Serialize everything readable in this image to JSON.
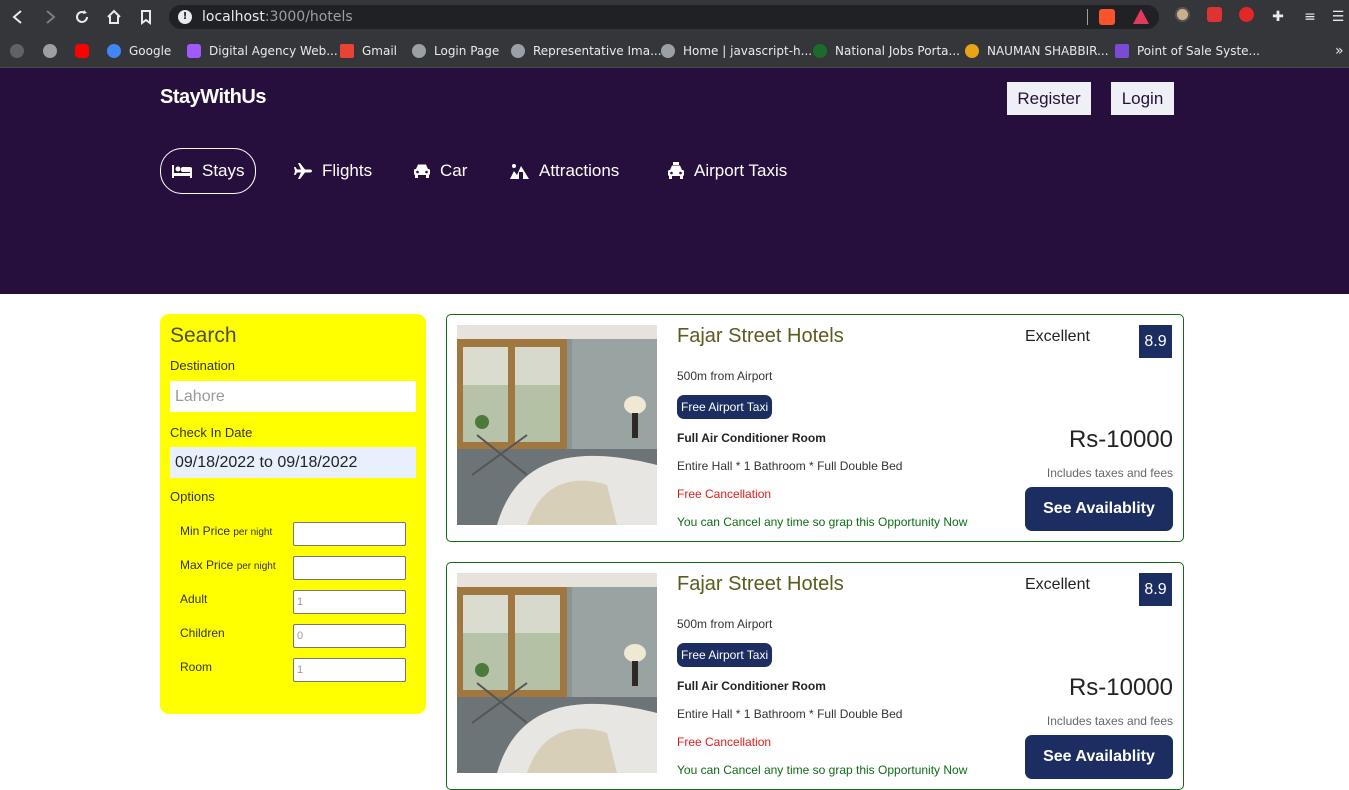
{
  "browser": {
    "url_host": "localhost",
    "url_path": ":3000/hotels",
    "bookmarks": [
      {
        "label": "",
        "color": "#9aa0a6"
      },
      {
        "label": "",
        "color": "#ff0000"
      },
      {
        "label": "Google",
        "color": "#4285f4"
      },
      {
        "label": "Digital Agency Web...",
        "color": "#a259ff"
      },
      {
        "label": "Gmail",
        "color": "#ea4335"
      },
      {
        "label": "Login Page",
        "color": "#9aa0a6"
      },
      {
        "label": "Representative Ima...",
        "color": "#9aa0a6"
      },
      {
        "label": "Home | javascript-h...",
        "color": "#9aa0a6"
      },
      {
        "label": "National Jobs Porta...",
        "color": "#1b6b2a"
      },
      {
        "label": "NAUMAN SHABBIR...",
        "color": "#e8a317"
      },
      {
        "label": "Point of Sale Syste...",
        "color": "#7b4bd6"
      }
    ],
    "more": "»"
  },
  "header": {
    "logo": "StayWithUs",
    "register": "Register",
    "login": "Login",
    "nav": [
      {
        "label": "Stays",
        "icon": "bed-icon",
        "active": true
      },
      {
        "label": "Flights",
        "icon": "plane-icon",
        "active": false
      },
      {
        "label": "Car",
        "icon": "car-icon",
        "active": false
      },
      {
        "label": "Attractions",
        "icon": "attractions-icon",
        "active": false
      },
      {
        "label": "Airport Taxis",
        "icon": "taxi-icon",
        "active": false
      }
    ]
  },
  "search": {
    "title": "Search",
    "destination_label": "Destination",
    "destination_value": "Lahore",
    "checkin_label": "Check In Date",
    "checkin_value": "09/18/2022 to 09/18/2022",
    "options_label": "Options",
    "options": [
      {
        "label": "Min Price",
        "suffix": "per night",
        "value": ""
      },
      {
        "label": "Max Price",
        "suffix": "per night",
        "value": ""
      },
      {
        "label": "Adult",
        "suffix": "",
        "value": "1"
      },
      {
        "label": "Children",
        "suffix": "",
        "value": "0"
      },
      {
        "label": "Room",
        "suffix": "",
        "value": "1"
      }
    ]
  },
  "results": [
    {
      "title": "Fajar Street Hotels",
      "distance": "500m from Airport",
      "taxi": "Free Airport Taxi",
      "room": "Full Air Conditioner Room",
      "features": "Entire Hall * 1 Bathroom * Full Double Bed",
      "cancel": "Free Cancellation",
      "cancel_sub": "You can Cancel any time so grap this Opportunity Now",
      "rating_text": "Excellent",
      "rating": "8.9",
      "price": "Rs-10000",
      "tax": "Includes taxes and fees",
      "button": "See Availablity"
    },
    {
      "title": "Fajar Street Hotels",
      "distance": "500m from Airport",
      "taxi": "Free Airport Taxi",
      "room": "Full Air Conditioner Room",
      "features": "Entire Hall * 1 Bathroom * Full Double Bed",
      "cancel": "Free Cancellation",
      "cancel_sub": "You can Cancel any time so grap this Opportunity Now",
      "rating_text": "Excellent",
      "rating": "8.9",
      "price": "Rs-10000",
      "tax": "Includes taxes and fees",
      "button": "See Availablity"
    }
  ],
  "colors": {
    "header_bg": "#260f3d",
    "sidebar_bg": "#ffff00",
    "accent": "#1b2d61",
    "cancel_red": "#e01b1b",
    "card_border": "#0f6b15"
  }
}
